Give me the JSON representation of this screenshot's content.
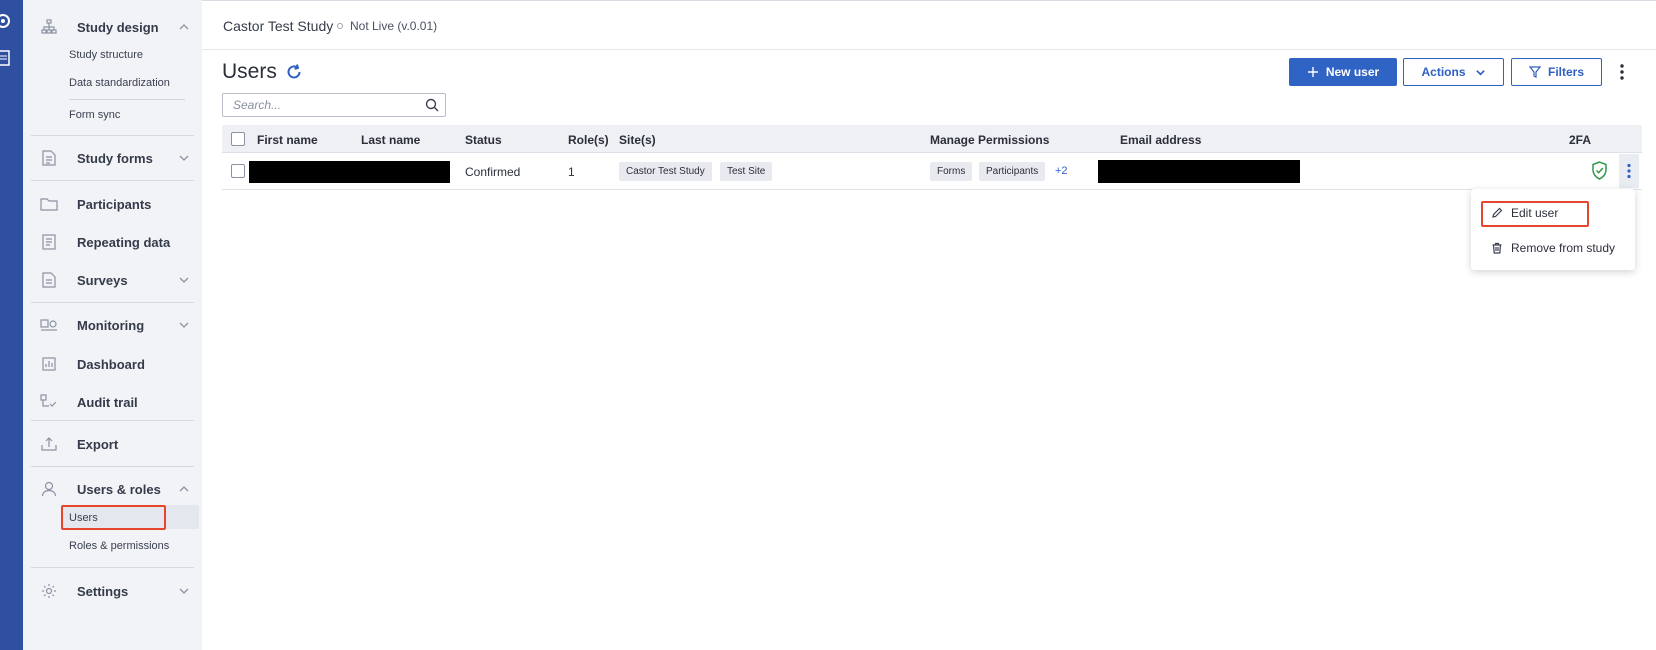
{
  "app": {
    "study_name": "Castor Test Study",
    "study_version": "Not Live (v.0.01)"
  },
  "sidebar": {
    "study_design": {
      "label": "Study design",
      "sub_items": [
        "Study structure",
        "Data standardization",
        "Form sync"
      ]
    },
    "items": [
      {
        "label": "Study forms",
        "icon": "form-icon"
      },
      {
        "label": "Participants",
        "icon": "folder-icon"
      },
      {
        "label": "Repeating data",
        "icon": "repeating-icon"
      },
      {
        "label": "Surveys",
        "icon": "survey-icon"
      },
      {
        "label": "Monitoring",
        "icon": "monitoring-icon"
      },
      {
        "label": "Dashboard",
        "icon": "bar-chart-icon"
      },
      {
        "label": "Audit trail",
        "icon": "audit-icon"
      },
      {
        "label": "Export",
        "icon": "export-icon"
      }
    ],
    "users_roles": {
      "label": "Users & roles",
      "sub_items": [
        "Users",
        "Roles & permissions"
      ],
      "active": "Users"
    },
    "settings": {
      "label": "Settings"
    }
  },
  "page": {
    "title": "Users",
    "search_placeholder": "Search..."
  },
  "toolbar": {
    "new_user_label": "New user",
    "actions_label": "Actions",
    "filters_label": "Filters"
  },
  "table": {
    "columns": [
      "First name",
      "Last name",
      "Status",
      "Role(s)",
      "Site(s)",
      "Manage Permissions",
      "Email address",
      "2FA"
    ],
    "rows": [
      {
        "status": "Confirmed",
        "roles": "1",
        "sites": [
          "Castor Test Study",
          "Test Site"
        ],
        "permissions": [
          "Forms",
          "Participants"
        ],
        "permissions_more": "+2",
        "two_factor": "enabled"
      }
    ]
  },
  "row_menu": {
    "items": [
      "Edit user",
      "Remove from study"
    ]
  },
  "colors": {
    "brand": "#2f4fa0",
    "primary": "#2f63c4",
    "highlight": "#e6462d",
    "success": "#2e9a4a"
  }
}
